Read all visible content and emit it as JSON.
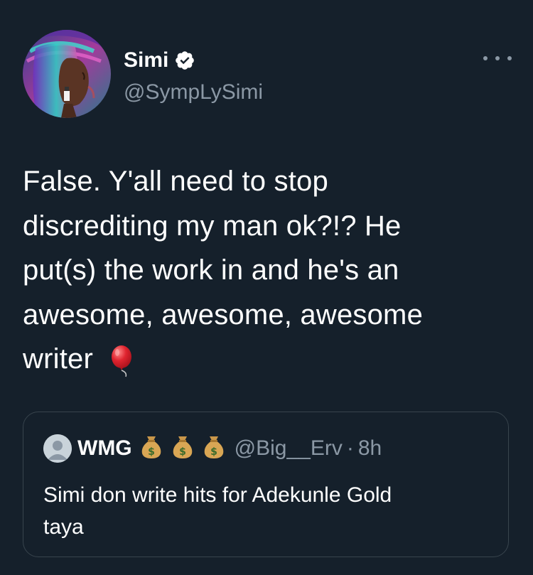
{
  "author": {
    "display_name": "Simi",
    "handle": "@SympLySimi",
    "verified_icon": "verified-badge-icon",
    "avatar_icon": "profile-photo"
  },
  "more_icon": "more-horizontal-icon",
  "tweet": {
    "line1": "False. Y'all need to stop",
    "line2": "discrediting my man ok?!? He",
    "line3": "put(s) the work in and he's an",
    "line4": "awesome, awesome, awesome",
    "line5": "writer",
    "emoji_icon": "red-balloon-icon"
  },
  "quoted": {
    "display_name": "WMG",
    "name_emoji_icons": [
      "money-bag-icon",
      "money-bag-icon",
      "money-bag-icon"
    ],
    "handle": "@Big__Erv",
    "separator": "·",
    "time": "8h",
    "text_line1": "Simi don write hits for Adekunle Gold",
    "text_line2": "taya"
  },
  "colors": {
    "background": "#15202b",
    "text": "#ffffff",
    "secondary_text": "#8b98a5",
    "card_border": "#38444d"
  }
}
